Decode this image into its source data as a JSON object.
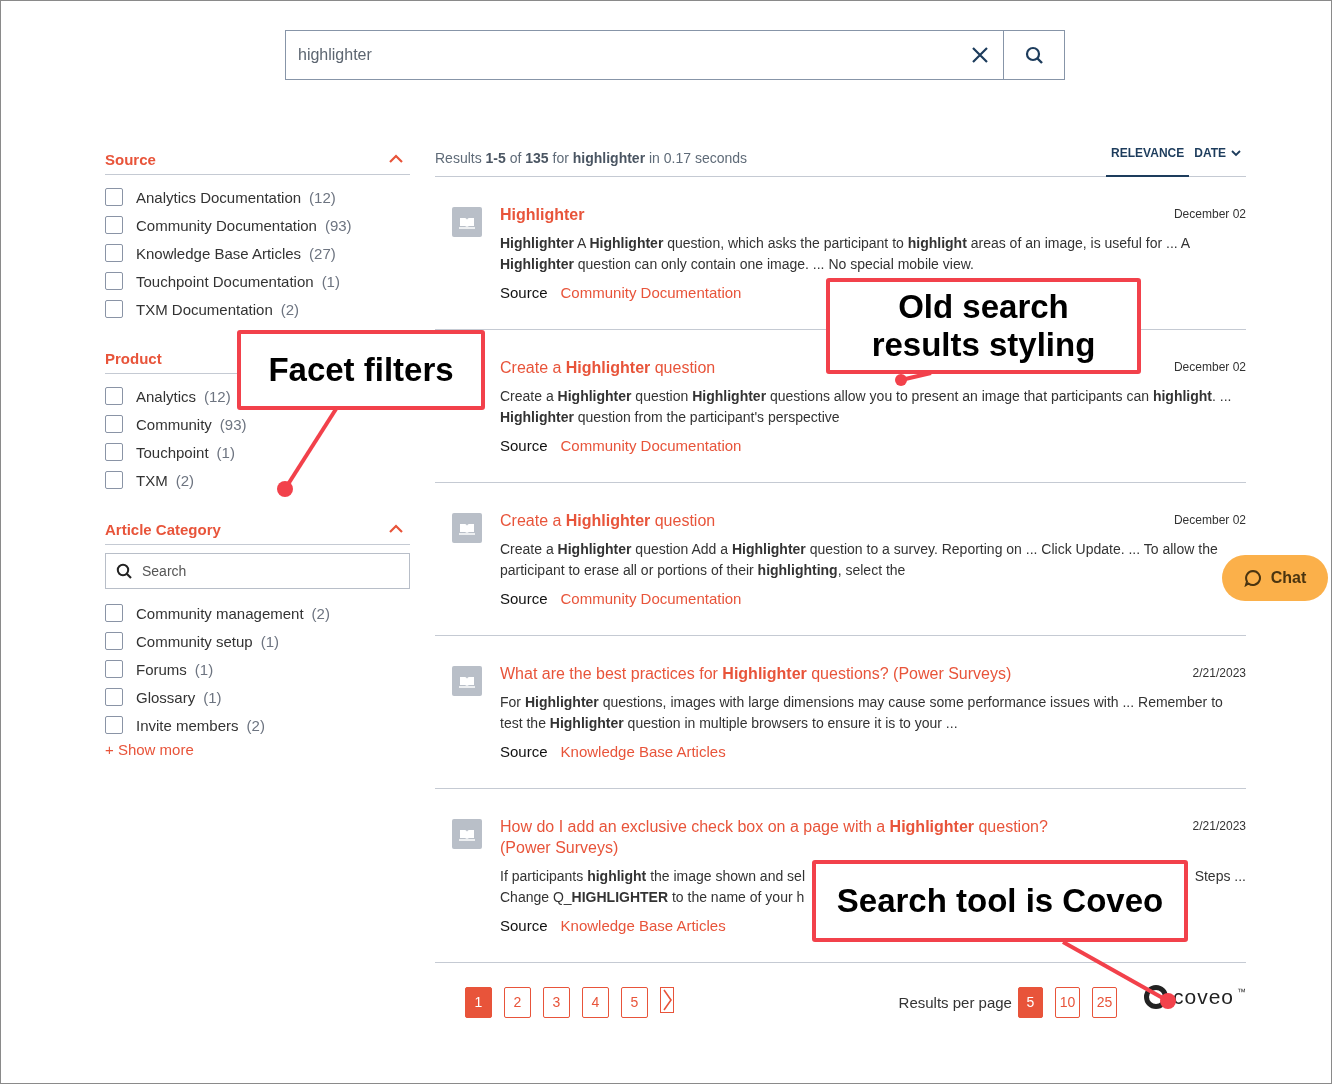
{
  "search": {
    "value": "highlighter"
  },
  "facets": [
    {
      "title": "Source",
      "expanded": true,
      "items": [
        {
          "label": "Analytics Documentation",
          "count": "(12)",
          "checked": false
        },
        {
          "label": "Community Documentation",
          "count": "(93)",
          "checked": false
        },
        {
          "label": "Knowledge Base Articles",
          "count": "(27)",
          "checked": false
        },
        {
          "label": "Touchpoint Documentation",
          "count": "(1)",
          "checked": false
        },
        {
          "label": "TXM Documentation",
          "count": "(2)",
          "checked": false
        }
      ]
    },
    {
      "title": "Product",
      "items": [
        {
          "label": "Analytics",
          "count": "(12)",
          "checked": false
        },
        {
          "label": "Community",
          "count": "(93)",
          "checked": false
        },
        {
          "label": "Touchpoint",
          "count": "(1)",
          "checked": false
        },
        {
          "label": "TXM",
          "count": "(2)",
          "checked": false
        }
      ]
    },
    {
      "title": "Article Category",
      "expanded": true,
      "search_placeholder": "Search",
      "items": [
        {
          "label": "Community management",
          "count": "(2)",
          "checked": false
        },
        {
          "label": "Community setup",
          "count": "(1)",
          "checked": false
        },
        {
          "label": "Forums",
          "count": "(1)",
          "checked": false
        },
        {
          "label": "Glossary",
          "count": "(1)",
          "checked": false
        },
        {
          "label": "Invite members",
          "count": "(2)",
          "checked": false
        }
      ],
      "show_more": "+ Show more"
    }
  ],
  "summary": "Results **1-5** of **135** for **highlighter** in 0.17 seconds",
  "sort": [
    {
      "label": "RELEVANCE",
      "selected": true
    },
    {
      "label": "DATE",
      "selected": false
    }
  ],
  "results": [
    {
      "icon": true,
      "title": "**Highlighter**",
      "date": "December 02",
      "snippet": "**Highlighter** A **Highlighter** question, which asks the participant to **highlight** areas of an image, is useful for ... A **Highlighter** question can only contain one image. ... No special mobile view.",
      "source_label": "Source",
      "source": "Community Documentation"
    },
    {
      "icon": false,
      "title": "Create a **Highlighter** question",
      "date": "December 02",
      "snippet": "Create a **Highlighter** question **Highlighter** questions allow you to present an image that participants can **highlight**. ... **Highlighter** question from the participant's perspective",
      "source_label": "Source",
      "source": "Community Documentation"
    },
    {
      "icon": true,
      "title": "Create a **Highlighter** question",
      "date": "December 02",
      "snippet": "Create a **Highlighter** question Add a **Highlighter** question to a survey. Reporting on ... Click Update. ... To allow the participant to erase all or portions of their **highlighting**, select the",
      "source_label": "Source",
      "source": "Community Documentation"
    },
    {
      "icon": true,
      "title": "What are the best practices for **Highlighter** questions? (Power Surveys)",
      "date": "2/21/2023",
      "snippet": "For **Highlighter** questions, images with large dimensions may cause some performance issues with ... Remember to test the **Highlighter** question in multiple browsers to ensure it is to your ...",
      "source_label": "Source",
      "source": "Knowledge Base Articles"
    },
    {
      "icon": true,
      "title": "How do I add an exclusive check box on a page with a **Highlighter** question? (Power Surveys)",
      "date": "2/21/2023",
      "snippet_lines": [
        [
          "If participants **highlight** the image shown and sel",
          "Steps ..."
        ],
        [
          "Change Q_**HIGHLIGHTER** to the name of your h"
        ]
      ],
      "source_label": "Source",
      "source": "Knowledge Base Articles"
    }
  ],
  "pagination": {
    "pages": [
      {
        "label": "1",
        "selected": true
      },
      {
        "label": "2",
        "selected": false
      },
      {
        "label": "3",
        "selected": false
      },
      {
        "label": "4",
        "selected": false
      },
      {
        "label": "5",
        "selected": false
      }
    ]
  },
  "results_per_page": {
    "label": "Results per page",
    "options": [
      {
        "label": "5",
        "selected": true
      },
      {
        "label": "10",
        "selected": false
      },
      {
        "label": "25",
        "selected": false
      }
    ]
  },
  "logo": {
    "text": "coveo",
    "mark": "™"
  },
  "chat": {
    "label": "Chat"
  },
  "annotations": [
    {
      "text": "Facet filters"
    },
    {
      "text": "Old search results styling"
    },
    {
      "text": "Search tool is Coveo"
    }
  ]
}
